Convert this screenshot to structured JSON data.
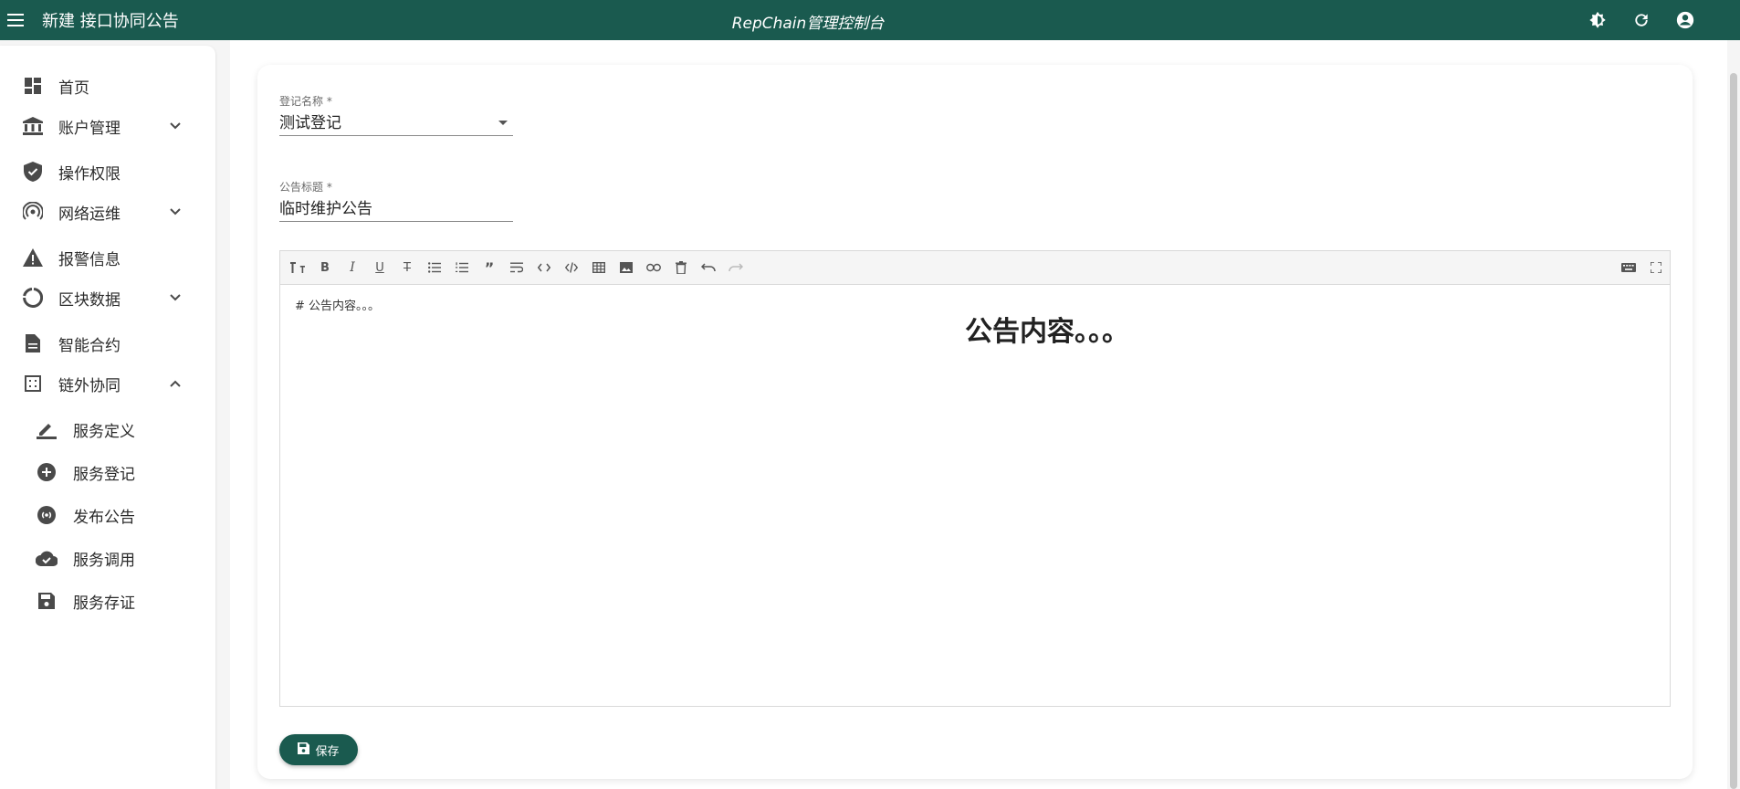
{
  "appbar": {
    "page_title": "新建 接口协同公告",
    "app_title": "RepChain管理控制台",
    "icons": [
      "menu-icon",
      "theme-toggle-icon",
      "refresh-icon",
      "account-icon"
    ]
  },
  "sidebar": {
    "items": [
      {
        "label": "首页",
        "icon": "dashboard-icon"
      },
      {
        "label": "账户管理",
        "icon": "bank-icon",
        "expandable": true,
        "expanded": false
      },
      {
        "label": "操作权限",
        "icon": "shield-check-icon"
      },
      {
        "label": "网络运维",
        "icon": "signal-icon",
        "expandable": true,
        "expanded": false
      },
      {
        "label": "报警信息",
        "icon": "warning-icon"
      },
      {
        "label": "区块数据",
        "icon": "donut-icon",
        "expandable": true,
        "expanded": false
      },
      {
        "label": "智能合约",
        "icon": "document-icon"
      },
      {
        "label": "链外协同",
        "icon": "grid-icon",
        "expandable": true,
        "expanded": true
      }
    ],
    "sub_items": [
      {
        "label": "服务定义",
        "icon": "pencil-icon"
      },
      {
        "label": "服务登记",
        "icon": "plus-circle-icon"
      },
      {
        "label": "发布公告",
        "icon": "broadcast-icon"
      },
      {
        "label": "服务调用",
        "icon": "cloud-check-icon"
      },
      {
        "label": "服务存证",
        "icon": "save-icon"
      }
    ]
  },
  "form": {
    "registration": {
      "label": "登记名称 *",
      "value": "测试登记"
    },
    "title_field": {
      "label": "公告标题 *",
      "value": "临时维护公告"
    }
  },
  "editor": {
    "source_text": "# 公告内容。。。",
    "preview_text": "公告内容。。。",
    "toolbar": [
      "heading-icon",
      "bold-icon",
      "italic-icon",
      "underline-icon",
      "strikethrough-icon",
      "bullet-list-icon",
      "numbered-list-icon",
      "quote-icon",
      "wrap-icon",
      "inline-code-icon",
      "code-block-icon",
      "table-icon",
      "image-icon",
      "link-icon",
      "clear-icon",
      "undo-icon",
      "redo-icon",
      "keyboard-icon",
      "fullscreen-icon"
    ]
  },
  "save_button": {
    "label": "保存",
    "icon": "save-icon"
  }
}
